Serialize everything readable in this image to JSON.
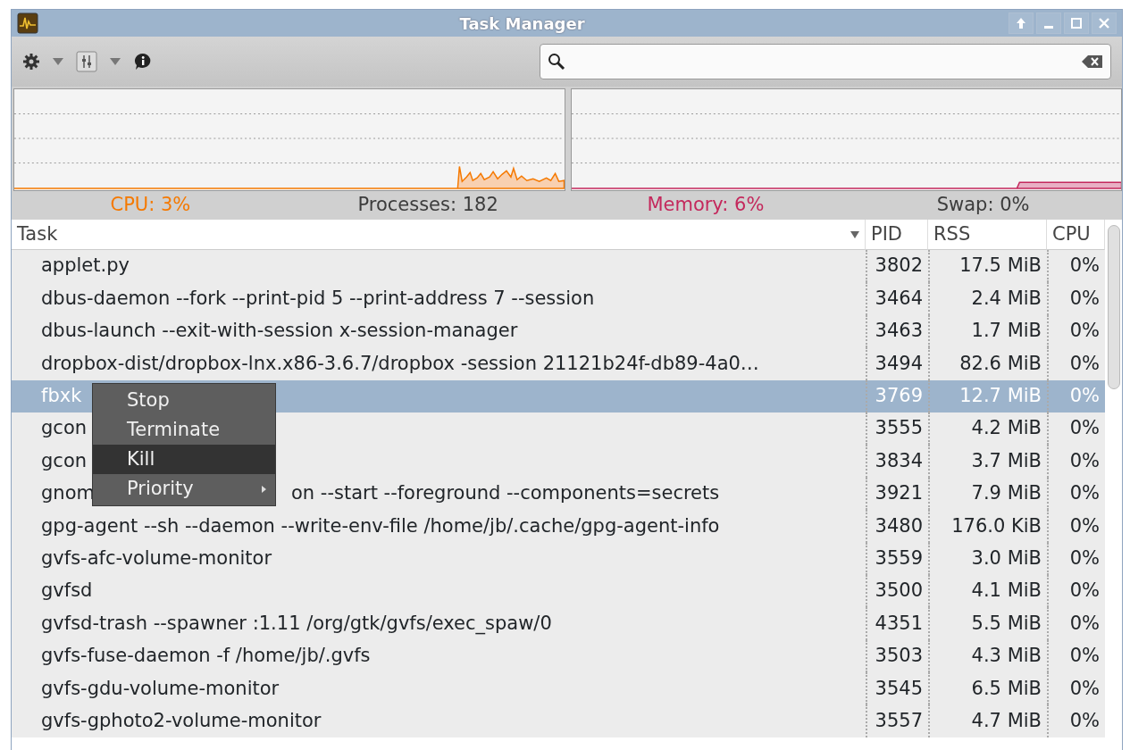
{
  "window": {
    "title": "Task Manager"
  },
  "status": [
    {
      "text": "CPU: 3%",
      "color": "#f57900"
    },
    {
      "text": "Processes: 182",
      "color": "#3c3c3c"
    },
    {
      "text": "Memory: 6%",
      "color": "#c4285c"
    },
    {
      "text": "Swap: 0%",
      "color": "#3c3c3c"
    }
  ],
  "table": {
    "columns": [
      "Task",
      "PID",
      "RSS",
      "CPU"
    ],
    "rows": [
      {
        "task": "applet.py",
        "pid": "3802",
        "rss": "17.5 MiB",
        "cpu": "0%",
        "selected": false
      },
      {
        "task": "dbus-daemon --fork --print-pid 5 --print-address 7 --session",
        "pid": "3464",
        "rss": "2.4 MiB",
        "cpu": "0%",
        "selected": false
      },
      {
        "task": "dbus-launch --exit-with-session x-session-manager",
        "pid": "3463",
        "rss": "1.7 MiB",
        "cpu": "0%",
        "selected": false
      },
      {
        "task": "dropbox-dist/dropbox-lnx.x86-3.6.7/dropbox -session 21121b24f-db89-4a0…",
        "pid": "3494",
        "rss": "82.6 MiB",
        "cpu": "0%",
        "selected": false
      },
      {
        "task": "fbxk",
        "pid": "3769",
        "rss": "12.7 MiB",
        "cpu": "0%",
        "selected": true
      },
      {
        "task": "gcon",
        "pid": "3555",
        "rss": "4.2 MiB",
        "cpu": "0%",
        "selected": false
      },
      {
        "task": "gcon",
        "pid": "3834",
        "rss": "3.7 MiB",
        "cpu": "0%",
        "selected": false
      },
      {
        "task": "gnom",
        "task_after": "on --start --foreground --components=secrets",
        "pid": "3921",
        "rss": "7.9 MiB",
        "cpu": "0%",
        "selected": false
      },
      {
        "task": "gpg-agent --sh --daemon --write-env-file /home/jb/.cache/gpg-agent-info",
        "pid": "3480",
        "rss": "176.0 KiB",
        "cpu": "0%",
        "selected": false
      },
      {
        "task": "gvfs-afc-volume-monitor",
        "pid": "3559",
        "rss": "3.0 MiB",
        "cpu": "0%",
        "selected": false
      },
      {
        "task": "gvfsd",
        "pid": "3500",
        "rss": "4.1 MiB",
        "cpu": "0%",
        "selected": false
      },
      {
        "task": "gvfsd-trash --spawner :1.11 /org/gtk/gvfs/exec_spaw/0",
        "pid": "4351",
        "rss": "5.5 MiB",
        "cpu": "0%",
        "selected": false
      },
      {
        "task": "gvfs-fuse-daemon -f /home/jb/.gvfs",
        "pid": "3503",
        "rss": "4.3 MiB",
        "cpu": "0%",
        "selected": false
      },
      {
        "task": "gvfs-gdu-volume-monitor",
        "pid": "3545",
        "rss": "6.5 MiB",
        "cpu": "0%",
        "selected": false
      },
      {
        "task": "gvfs-gphoto2-volume-monitor",
        "pid": "3557",
        "rss": "4.7 MiB",
        "cpu": "0%",
        "selected": false
      }
    ]
  },
  "context_menu": {
    "items": [
      {
        "label": "Stop",
        "selected": false,
        "submenu": false
      },
      {
        "label": "Terminate",
        "selected": false,
        "submenu": false
      },
      {
        "label": "Kill",
        "selected": true,
        "submenu": false
      },
      {
        "label": "Priority",
        "selected": false,
        "submenu": true
      }
    ]
  }
}
